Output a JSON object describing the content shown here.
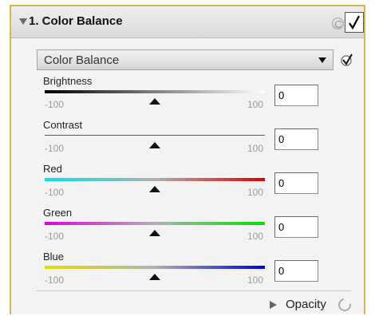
{
  "panel": {
    "title": "1. Color Balance",
    "enabled": true
  },
  "control": {
    "mode_label": "Color Balance",
    "apply_enabled": true
  },
  "sliders": [
    {
      "label": "Brightness",
      "min": "-100",
      "max": "100",
      "value": "0",
      "level": 0.5
    },
    {
      "label": "Contrast",
      "min": "-100",
      "max": "100",
      "value": "0",
      "level": 0.5
    },
    {
      "label": "Red",
      "min": "-100",
      "max": "100",
      "value": "0",
      "level": 0.5
    },
    {
      "label": "Green",
      "min": "-100",
      "max": "100",
      "value": "0",
      "level": 0.5
    },
    {
      "label": "Blue",
      "min": "-100",
      "max": "100",
      "value": "0",
      "level": 0.5
    }
  ],
  "opacity": {
    "label": "Opacity"
  },
  "icons": {
    "collapse": "disclosure-triangle-icon",
    "reset": "refresh-icon",
    "remove": "close-icon",
    "enable": "checkmark-icon",
    "dropdown": "chevron-down-icon",
    "apply": "checkmark-icon",
    "opacity_expand": "disclosure-triangle-icon",
    "opacity_indicator": "progress-ring-icon"
  },
  "colors": {
    "panel_border": "#d8b64a",
    "red_start": "#00e5e5",
    "red_end": "#e00000",
    "green_start": "#e000e0",
    "green_end": "#00e000",
    "blue_start": "#e0e000",
    "blue_end": "#0000e0"
  }
}
